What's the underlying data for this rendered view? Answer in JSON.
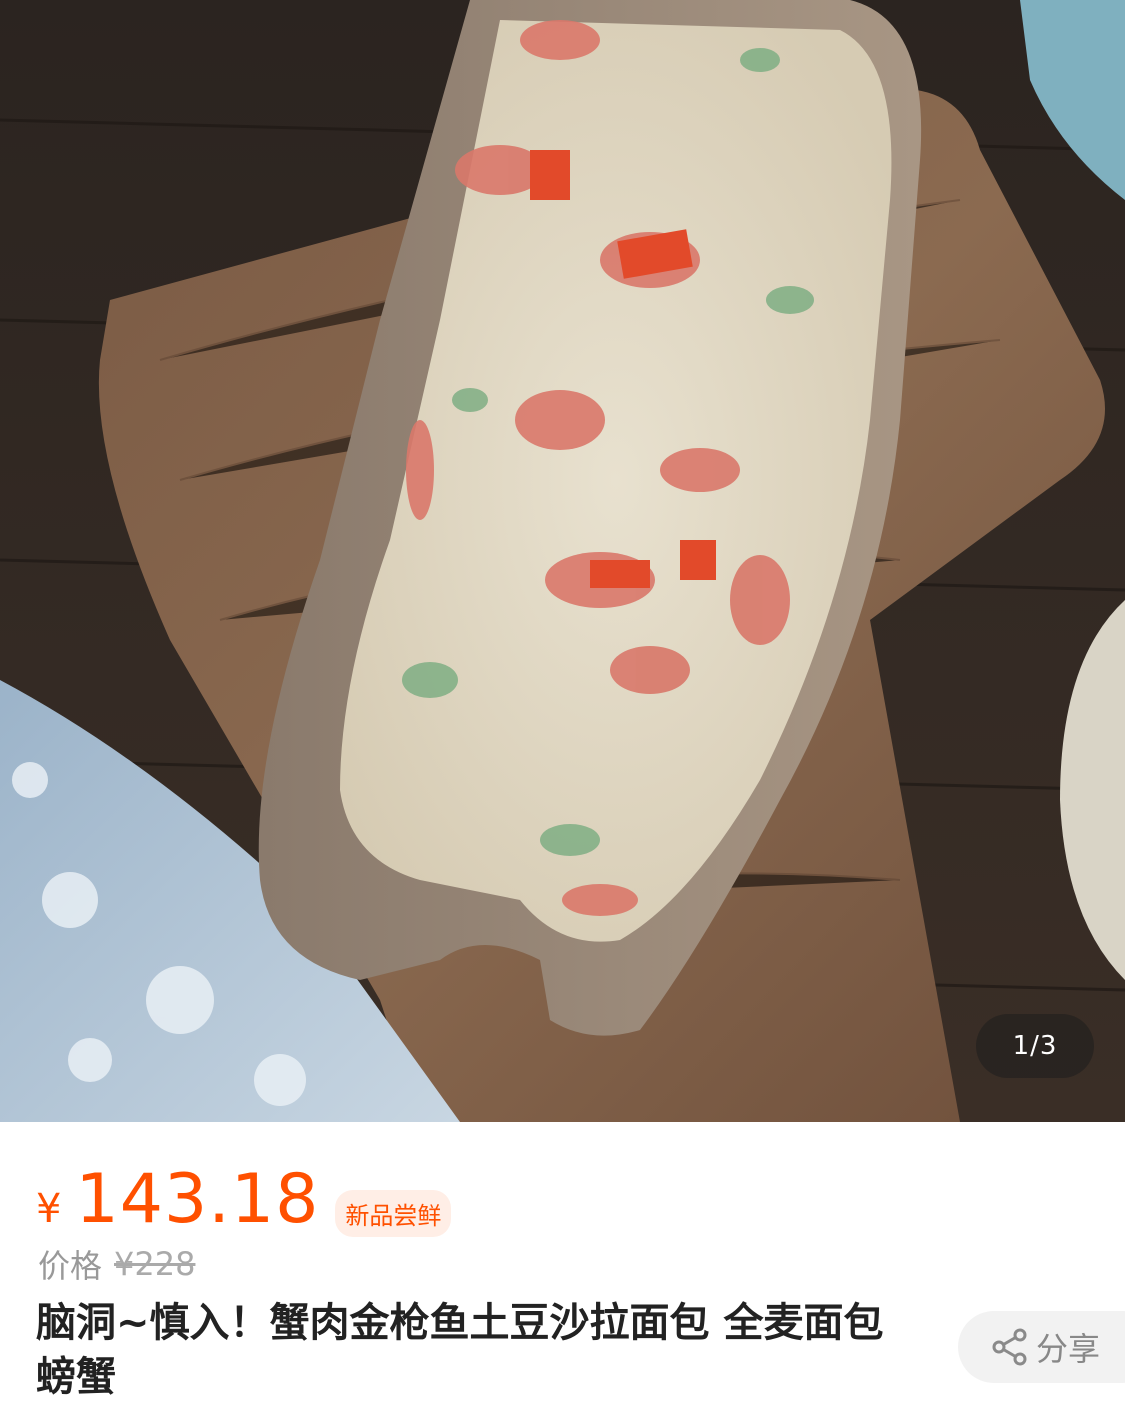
{
  "gallery": {
    "counter": "1/3",
    "image_alt": "crab tuna potato salad bread"
  },
  "product": {
    "currency": "¥",
    "price": "143.18",
    "tag": "新品尝鲜",
    "original_price_label": "价格",
    "original_price": "¥228",
    "title": "脑洞~慎入！蟹肉金枪鱼土豆沙拉面包 全麦面包 螃蟹"
  },
  "share": {
    "label": "分享",
    "icon": "share-icon"
  },
  "colors": {
    "accent": "#ff5000",
    "tag_bg": "#ffeee6",
    "muted_text": "#999999"
  }
}
